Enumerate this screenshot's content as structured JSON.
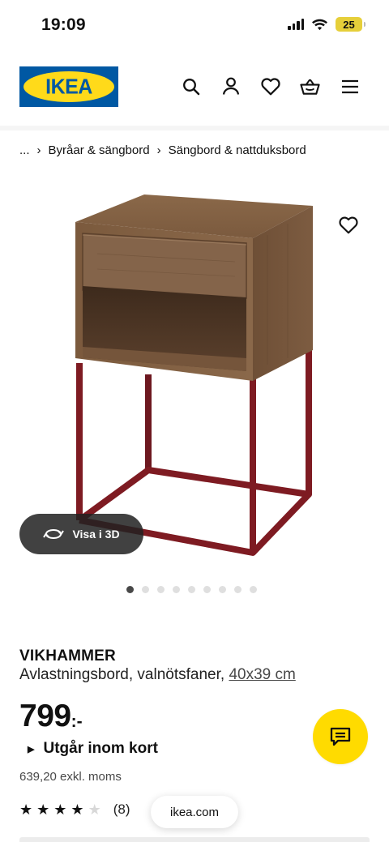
{
  "status_bar": {
    "time": "19:09",
    "battery": "25"
  },
  "header": {
    "logo_text": "IKEA",
    "icons": [
      "search-icon",
      "user-icon",
      "heart-icon",
      "basket-icon",
      "menu-icon"
    ]
  },
  "breadcrumb": {
    "ellipsis": "...",
    "items": [
      "Byråar & sängbord",
      "Sängbord & nattduksbord"
    ]
  },
  "gallery": {
    "view_3d_label": "Visa i 3D",
    "total_images": 9,
    "active_index": 0
  },
  "product": {
    "name": "VIKHAMMER",
    "description": "Avlastningsbord, valnötsfaner,",
    "size_link": "40x39 cm",
    "price": "799",
    "price_suffix": ":-",
    "availability": "Utgår inom kort",
    "price_excl_vat": "639,20 exkl. moms",
    "rating_value": 4,
    "rating_max": 5,
    "review_count": "(8)"
  },
  "browser": {
    "url": "ikea.com"
  },
  "colors": {
    "ikea_blue": "#0058a3",
    "ikea_yellow": "#ffda1a",
    "chat_yellow": "#ffdb00",
    "wood": "#7a5b40",
    "frame_red": "#7e1b22"
  }
}
